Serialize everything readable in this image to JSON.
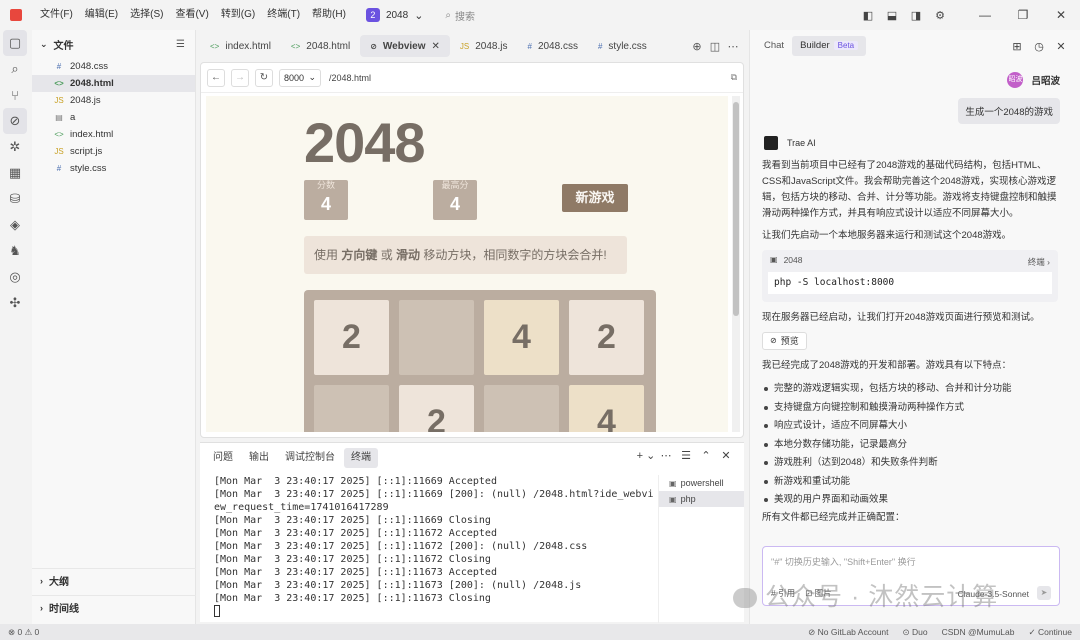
{
  "titlebar": {
    "menus": [
      "文件(F)",
      "编辑(E)",
      "选择(S)",
      "查看(V)",
      "转到(G)",
      "终端(T)",
      "帮助(H)"
    ],
    "project_badge": "2",
    "project_name": "2048",
    "search_placeholder": "搜索"
  },
  "explorer": {
    "title": "文件",
    "files": [
      {
        "name": "2048.css",
        "icon": "#",
        "type": "css"
      },
      {
        "name": "2048.html",
        "icon": "<>",
        "type": "html"
      },
      {
        "name": "2048.js",
        "icon": "JS",
        "type": "js"
      },
      {
        "name": "a",
        "icon": "▤",
        "type": "txt"
      },
      {
        "name": "index.html",
        "icon": "<>",
        "type": "html"
      },
      {
        "name": "script.js",
        "icon": "JS",
        "type": "js"
      },
      {
        "name": "style.css",
        "icon": "#",
        "type": "css"
      }
    ],
    "outline": "大纲",
    "timeline": "时间线"
  },
  "tabs": [
    {
      "label": "index.html",
      "icon": "<>"
    },
    {
      "label": "2048.html",
      "icon": "<>"
    },
    {
      "label": "Webview",
      "icon": "⊘"
    },
    {
      "label": "2048.js",
      "icon": "JS"
    },
    {
      "label": "2048.css",
      "icon": "#"
    },
    {
      "label": "style.css",
      "icon": "#"
    }
  ],
  "webview": {
    "port": "8000",
    "url": "/2048.html"
  },
  "game": {
    "title": "2048",
    "score_label": "分数",
    "score": "4",
    "best_label": "最高分",
    "best": "4",
    "new_game": "新游戏",
    "instr_1": "使用 ",
    "instr_key1": "方向键",
    "instr_2": " 或 ",
    "instr_key2": "滑动",
    "instr_3": " 移动方块，相同数字的方块会合并!",
    "cells": [
      "2",
      "",
      "4",
      "2",
      "",
      "2",
      "",
      "4"
    ]
  },
  "panel": {
    "tabs": [
      "问题",
      "输出",
      "调试控制台",
      "终端"
    ],
    "terminal_lines": [
      "[Mon Mar  3 23:40:17 2025] [::1]:11669 Accepted",
      "[Mon Mar  3 23:40:17 2025] [::1]:11669 [200]: (null) /2048.html?ide_webview_request_time=1741016417289",
      "[Mon Mar  3 23:40:17 2025] [::1]:11669 Closing",
      "[Mon Mar  3 23:40:17 2025] [::1]:11672 Accepted",
      "[Mon Mar  3 23:40:17 2025] [::1]:11672 [200]: (null) /2048.css",
      "[Mon Mar  3 23:40:17 2025] [::1]:11672 Closing",
      "[Mon Mar  3 23:40:17 2025] [::1]:11673 Accepted",
      "[Mon Mar  3 23:40:17 2025] [::1]:11673 [200]: (null) /2048.js",
      "[Mon Mar  3 23:40:17 2025] [::1]:11673 Closing"
    ],
    "shells": [
      "powershell",
      "php"
    ]
  },
  "chat": {
    "tab_chat": "Chat",
    "tab_builder": "Builder",
    "beta": "Beta",
    "user_avatar": "昭波",
    "user_name": "吕昭波",
    "user_message": "生成一个2048的游戏",
    "ai_name": "Trae AI",
    "para1": "我看到当前项目中已经有了2048游戏的基础代码结构，包括HTML、CSS和JavaScript文件。我会帮助完善这个2048游戏，实现核心游戏逻辑，包括方块的移动、合并、计分等功能。游戏将支持键盘控制和触摸滑动两种操作方式，并具有响应式设计以适应不同屏幕大小。",
    "para2": "让我们先启动一个本地服务器来运行和测试这个2048游戏。",
    "code_title": "2048",
    "code_action": "终端 ›",
    "code": "php -S localhost:8000",
    "para3": "现在服务器已经启动，让我们打开2048游戏页面进行预览和测试。",
    "preview_label": "预览",
    "para4": "我已经完成了2048游戏的开发和部署。游戏具有以下特点：",
    "features": [
      "完整的游戏逻辑实现，包括方块的移动、合并和计分功能",
      "支持键盘方向键控制和触摸滑动两种操作方式",
      "响应式设计，适应不同屏幕大小",
      "本地分数存储功能，记录最高分",
      "游戏胜利（达到2048）和失败条件判断",
      "新游戏和重试功能",
      "美观的用户界面和动画效果"
    ],
    "para5": "所有文件都已经完成并正确配置：",
    "input_placeholder": "\"#\" 切换历史输入, \"Shift+Enter\" 换行",
    "input_tool_1": "# 引用",
    "input_tool_2": "⊡ 图片",
    "model": "Claude-3.5-Sonnet"
  },
  "watermark": "公众号 · 沐然云计算",
  "statusbar": {
    "left": "⊗ 0  ⚠ 0",
    "gitlab": "⊘ No GitLab Account",
    "duo": "⊙ Duo",
    "continue": "✓ Continue",
    "csdn": "CSDN @MumuLab"
  }
}
